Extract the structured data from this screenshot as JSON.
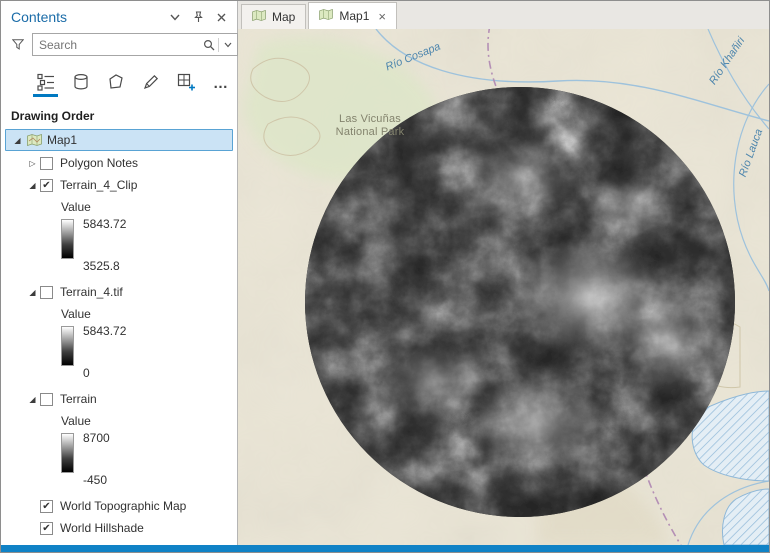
{
  "window": {
    "accent_color": "#0079c1",
    "bottom_bar_color": "#1082c6",
    "selection_bg": "#cbe3f5"
  },
  "contents": {
    "title": "Contents",
    "search": {
      "placeholder": "Search"
    },
    "toolbar": {
      "ellipsis": "…"
    },
    "drawing_order_label": "Drawing Order",
    "tree": {
      "map": {
        "label": "Map1",
        "arrow": "◢"
      },
      "layers": [
        {
          "label": "Polygon Notes",
          "arrow": "▷",
          "check": ""
        },
        {
          "label": "Terrain_4_Clip",
          "arrow": "◢",
          "check": "✔",
          "value_label": "Value",
          "max": "5843.72",
          "min": "3525.8"
        },
        {
          "label": "Terrain_4.tif",
          "arrow": "◢",
          "check": "",
          "value_label": "Value",
          "max": "5843.72",
          "min": "0"
        },
        {
          "label": "Terrain",
          "arrow": "◢",
          "check": "",
          "value_label": "Value",
          "max": "8700",
          "min": "-450"
        },
        {
          "label": "World Topographic Map",
          "arrow": "",
          "check": "✔"
        },
        {
          "label": "World Hillshade",
          "arrow": "",
          "check": "✔"
        }
      ]
    }
  },
  "view_tabs": [
    {
      "label": "Map"
    },
    {
      "label": "Map1",
      "close": "×"
    }
  ],
  "map": {
    "base_color": "#eae5d5",
    "labels": {
      "park_line1": "Las Vicuñas",
      "park_line2": "National Park",
      "river1": "Río Cosapa",
      "river2": "Río Khañiri",
      "river3": "Río Lauca"
    }
  }
}
